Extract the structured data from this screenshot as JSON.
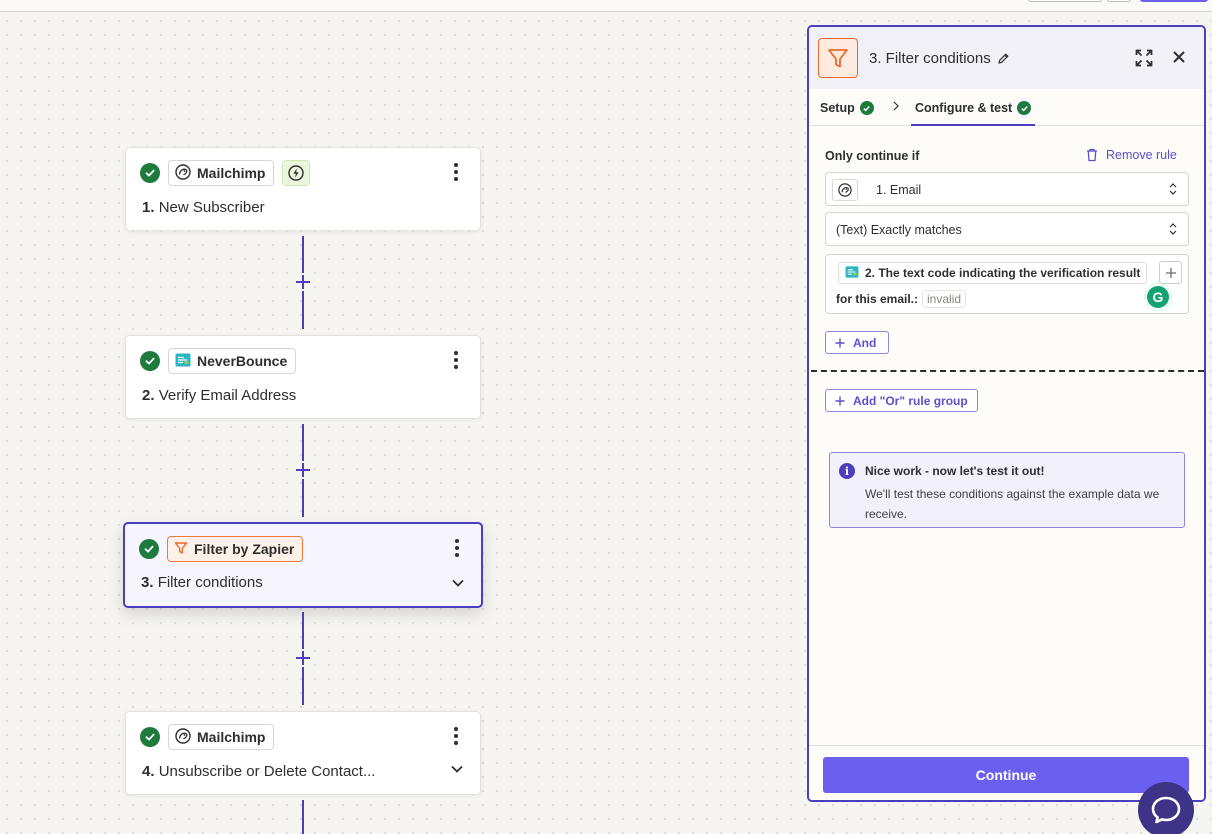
{
  "canvas": {
    "steps": [
      {
        "app": "Mailchimp",
        "number": "1.",
        "name": "New Subscriber",
        "app_icon": "mailchimp-logo-icon",
        "trigger_icon": "lightning-bolt-icon"
      },
      {
        "app": "NeverBounce",
        "number": "2.",
        "name": "Verify Email Address",
        "app_icon": "neverbounce-logo-icon"
      },
      {
        "app": "Filter by Zapier",
        "number": "3.",
        "name": "Filter conditions",
        "app_icon": "filter-funnel-icon"
      },
      {
        "app": "Mailchimp",
        "number": "4.",
        "name": "Unsubscribe or Delete Contact...",
        "app_icon": "mailchimp-logo-icon"
      }
    ],
    "colors": {
      "accent": "#4b3fbd",
      "success": "#1f7a3d",
      "filter_orange": "#f07a3e",
      "primary_button": "#6b5ff0"
    }
  },
  "panel": {
    "title": "3. Filter conditions",
    "tabs": [
      {
        "label": "Setup"
      },
      {
        "label": "Configure & test"
      }
    ],
    "only_continue_label": "Only continue if",
    "remove_rule_label": "Remove rule",
    "rule": {
      "field": "1. Email",
      "condition": "(Text) Exactly matches",
      "value_line1": "2. The text code indicating the verification result",
      "value_line2": "for this email.:",
      "value_sample": "invalid"
    },
    "and_label": "And",
    "or_label": "Add \"Or\" rule group",
    "info": {
      "title": "Nice work - now let's test it out!",
      "text": "We'll test these conditions against the example data we receive."
    },
    "continue_label": "Continue"
  }
}
